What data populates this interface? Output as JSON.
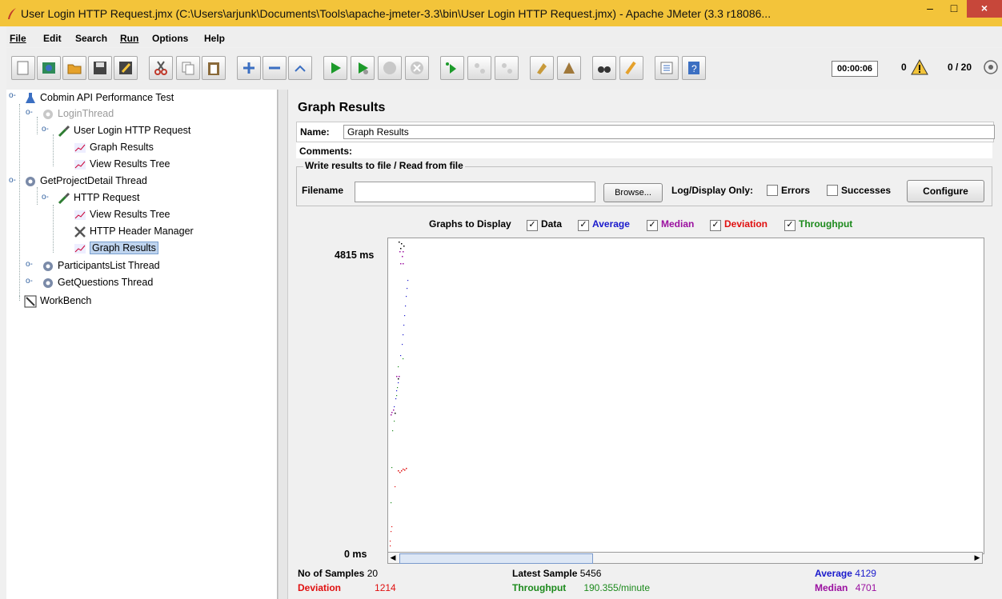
{
  "window": {
    "title": "User Login HTTP Request.jmx (C:\\Users\\arjunk\\Documents\\Tools\\apache-jmeter-3.3\\bin\\User Login HTTP Request.jmx) - Apache JMeter (3.3 r18086...",
    "minimize": "–",
    "maximize": "□",
    "close": "×"
  },
  "menu": [
    "File",
    "Edit",
    "Search",
    "Run",
    "Options",
    "Help"
  ],
  "toolbar": {
    "timer": "00:00:06",
    "error_count": "0",
    "threads": "0 / 20"
  },
  "tree": {
    "root": "Cobmin API Performance Test",
    "login_thread": "LoginThread",
    "user_login_request": "User Login HTTP Request",
    "graph_results_1": "Graph Results",
    "view_results_tree_1": "View Results Tree",
    "project_detail_thread": "GetProjectDetail Thread",
    "http_request": "HTTP Request",
    "view_results_tree_2": "View Results Tree",
    "header_manager": "HTTP Header Manager",
    "graph_results_2": "Graph Results",
    "participants_thread": "ParticipantsList Thread",
    "questions_thread": "GetQuestions Thread",
    "workbench": "WorkBench"
  },
  "panel": {
    "heading": "Graph Results",
    "name_label": "Name:",
    "name_value": "Graph Results",
    "comments_label": "Comments:",
    "file_group_label": "Write results to file / Read from file",
    "filename_label": "Filename",
    "browse": "Browse...",
    "log_display_only": "Log/Display Only:",
    "errors": "Errors",
    "successes": "Successes",
    "configure": "Configure"
  },
  "graphs_to_display": {
    "label": "Graphs to Display",
    "data": "Data",
    "average": "Average",
    "median": "Median",
    "deviation": "Deviation",
    "throughput": "Throughput"
  },
  "colors": {
    "data": "#000000",
    "average": "#1a1acc",
    "median": "#9b10a0",
    "deviation": "#e01010",
    "throughput": "#1c8a1c"
  },
  "graph": {
    "y_max_label": "4815 ms",
    "y_min_label": "0 ms"
  },
  "stats": {
    "samples_label": "No of Samples",
    "samples_value": "20",
    "latest_label": "Latest Sample",
    "latest_value": "5456",
    "average_label": "Average",
    "average_value": "4129",
    "deviation_label": "Deviation",
    "deviation_value": "1214",
    "throughput_label": "Throughput",
    "throughput_value": "190.355/minute",
    "median_label": "Median",
    "median_value": "4701"
  }
}
